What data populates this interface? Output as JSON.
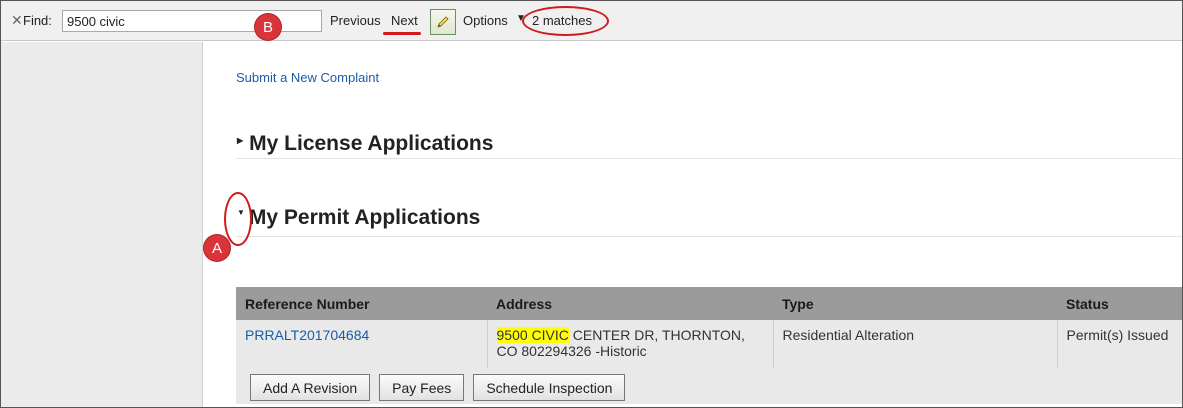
{
  "findbar": {
    "find_label": "Find:",
    "query": "9500 civic",
    "previous_label": "Previous",
    "next_label": "Next",
    "options_label": "Options",
    "matches_label": "2 matches"
  },
  "annotations": {
    "marker_a": "A",
    "marker_b": "B",
    "color": "#d11a1a"
  },
  "main": {
    "submit_link": "Submit a New Complaint",
    "license_heading": "My License Applications",
    "permit_heading": "My Permit Applications"
  },
  "permits_table": {
    "headers": [
      "Reference Number",
      "Address",
      "Type",
      "Status"
    ],
    "rows": [
      {
        "reference": "PRRALT201704684",
        "address_highlight": "9500 CIVIC",
        "address_rest": " CENTER DR, THORNTON, CO 802294326 -Historic",
        "type": "Residential Alteration",
        "status": "Permit(s) Issued"
      }
    ],
    "actions": [
      "Add A Revision",
      "Pay Fees",
      "Schedule Inspection"
    ]
  },
  "colors": {
    "link": "#1a5da6",
    "table_header": "#9b9b9b",
    "row_bg": "#e9e9e9",
    "highlight": "#ffff00"
  }
}
